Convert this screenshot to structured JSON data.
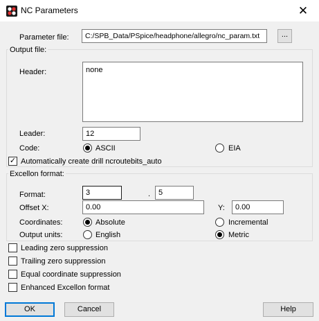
{
  "window": {
    "title": "NC Parameters",
    "close_glyph": "✕"
  },
  "parameter_file": {
    "label": "Parameter file:",
    "value": "C:/SPB_Data/PSpice/headphone/allegro/nc_param.txt",
    "browse_label": "..."
  },
  "output_file": {
    "group_label": "Output file:",
    "header_label": "Header:",
    "header_value": "none",
    "leader_label": "Leader:",
    "leader_value": "12",
    "code_label": "Code:",
    "code_options": [
      {
        "label": "ASCII",
        "selected": true
      },
      {
        "label": "EIA",
        "selected": false
      }
    ]
  },
  "auto_drill": {
    "label": "Automatically create drill ncroutebits_auto",
    "checked": true
  },
  "excellon": {
    "group_label": "Excellon format:",
    "format_label": "Format:",
    "format_int": "3",
    "format_sep": ".",
    "format_dec": "5",
    "offset_x_label": "Offset X:",
    "offset_x_value": "0.00",
    "offset_y_label": "Y:",
    "offset_y_value": "0.00",
    "coordinates_label": "Coordinates:",
    "coordinates_options": [
      {
        "label": "Absolute",
        "selected": true
      },
      {
        "label": "Incremental",
        "selected": false
      }
    ],
    "units_label": "Output units:",
    "units_options": [
      {
        "label": "English",
        "selected": false
      },
      {
        "label": "Metric",
        "selected": true
      }
    ]
  },
  "checkboxes": [
    {
      "label": "Leading zero suppression",
      "checked": false
    },
    {
      "label": "Trailing zero suppression",
      "checked": false
    },
    {
      "label": "Equal coordinate suppression",
      "checked": false
    },
    {
      "label": "Enhanced Excellon format",
      "checked": false
    }
  ],
  "buttons": {
    "ok": "OK",
    "cancel": "Cancel",
    "help": "Help"
  },
  "check_glyph": "✓",
  "colors": {
    "accent": "#0078d7",
    "background": "#f0f0f0"
  }
}
